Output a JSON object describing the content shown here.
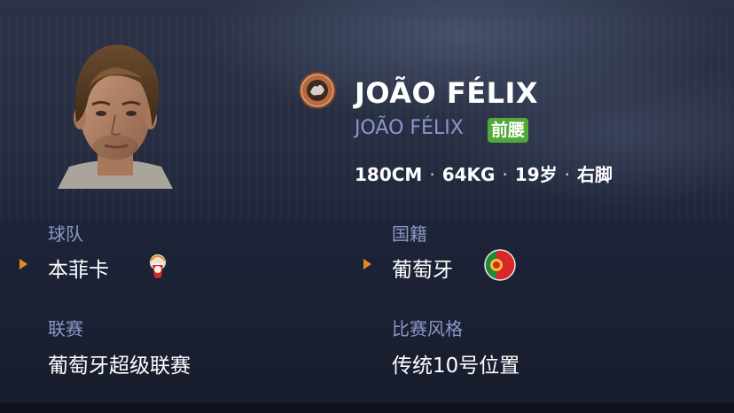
{
  "player": {
    "name": "JOÃO FÉLIX",
    "name_sub": "JOÃO FÉLIX",
    "position": "前腰",
    "height": "180CM",
    "weight": "64KG",
    "age": "19岁",
    "foot": "右脚",
    "separator": "·"
  },
  "info": {
    "team_label": "球队",
    "team_value": "本菲卡",
    "nationality_label": "国籍",
    "nationality_value": "葡萄牙",
    "league_label": "联赛",
    "league_value": "葡萄牙超级联赛",
    "style_label": "比赛风格",
    "style_value": "传统10号位置"
  },
  "icons": {
    "club_crest": "club-crest-icon",
    "team_badge": "benfica-badge-icon",
    "nation_flag": "portugal-flag-icon",
    "arrow": "orange-triangle-icon"
  },
  "colors": {
    "accent_orange": "#e88a1c",
    "badge_green": "#52a83a",
    "label_blue": "#8c97c9"
  }
}
